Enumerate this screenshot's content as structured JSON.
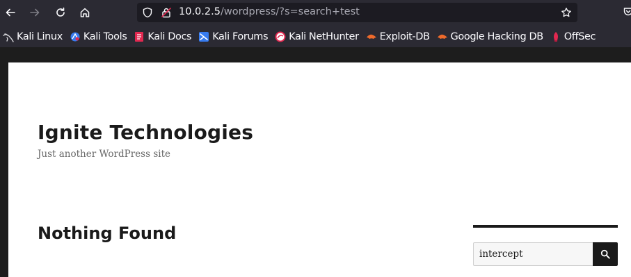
{
  "browser": {
    "url_host": "10.0.2.5",
    "url_path": "/wordpress/?s=search+test",
    "bookmarks": [
      {
        "label": "Kali Linux",
        "icon": "kali-dragon-icon"
      },
      {
        "label": "Kali Tools",
        "icon": "kali-tools-icon"
      },
      {
        "label": "Kali Docs",
        "icon": "kali-docs-icon"
      },
      {
        "label": "Kali Forums",
        "icon": "kali-forums-icon"
      },
      {
        "label": "Kali NetHunter",
        "icon": "kali-nethunter-icon"
      },
      {
        "label": "Exploit-DB",
        "icon": "exploit-db-icon"
      },
      {
        "label": "Google Hacking DB",
        "icon": "google-hacking-db-icon"
      },
      {
        "label": "OffSec",
        "icon": "offsec-icon"
      }
    ]
  },
  "site": {
    "title": "Ignite Technologies",
    "description": "Just another WordPress site"
  },
  "main": {
    "heading": "Nothing Found"
  },
  "sidebar": {
    "search_value": "intercept"
  },
  "colors": {
    "chrome_bg": "#2b2a33",
    "urlbar_bg": "#1c1b22",
    "page_bg": "#ffffff",
    "text_dark": "#1a1a1a"
  }
}
